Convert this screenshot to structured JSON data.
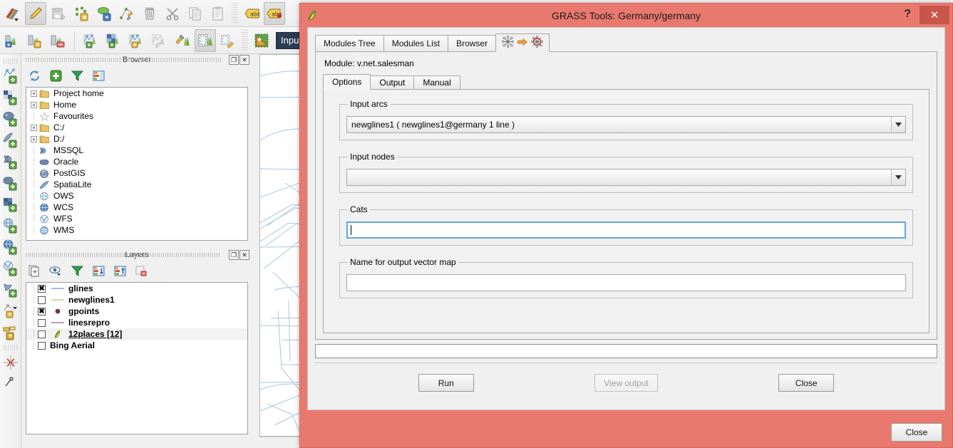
{
  "app": {
    "toolbar_row1": [
      {
        "name": "pencils-dropdown-icon",
        "label": "Current Edits"
      },
      {
        "name": "toggle-editing-icon",
        "label": "Toggle Editing",
        "active": true
      },
      {
        "name": "save-layer-edits-icon",
        "label": "Save Layer Edits"
      },
      {
        "name": "add-feature-icon",
        "label": "Add Feature"
      },
      {
        "name": "move-feature-icon",
        "label": "Move Feature"
      },
      {
        "name": "node-tool-icon",
        "label": "Node Tool"
      },
      {
        "name": "delete-selected-icon",
        "label": "Delete Selected"
      },
      {
        "name": "cut-features-icon",
        "label": "Cut Features"
      },
      {
        "name": "copy-features-icon",
        "label": "Copy Features"
      },
      {
        "name": "paste-features-icon",
        "label": "Paste Features"
      },
      {
        "name": "label-icon",
        "label": "Layer Labeling Options"
      },
      {
        "name": "label-pin-icon",
        "label": "Pin Labels",
        "active": true
      }
    ],
    "toolbar_row2": [
      {
        "name": "grass-open-mapset-icon",
        "label": "Open Mapset"
      },
      {
        "name": "grass-new-mapset-icon",
        "label": "New Mapset"
      },
      {
        "name": "grass-close-mapset-icon",
        "label": "Close Mapset"
      },
      {
        "name": "grass-add-vector-icon",
        "label": "Add GRASS Vector Layer"
      },
      {
        "name": "grass-add-raster-icon",
        "label": "Add GRASS Raster Layer"
      },
      {
        "name": "grass-new-vector-icon",
        "label": "Create New GRASS Vector Layer"
      },
      {
        "name": "grass-edit-vector-icon",
        "label": "Edit GRASS Vector Layer"
      },
      {
        "name": "grass-tools-icon",
        "label": "Open GRASS Tools"
      },
      {
        "name": "grass-region-icon",
        "label": "Display Current GRASS Region",
        "active": true
      },
      {
        "name": "grass-edit-region-icon",
        "label": "Edit Current GRASS Region"
      },
      {
        "name": "select-features-icon",
        "label": "Select Features"
      }
    ],
    "toolbar_combo_value": "Input",
    "left_toolbar": [
      {
        "name": "add-vector-layer-icon",
        "label": "Add Vector Layer"
      },
      {
        "name": "add-raster-layer-icon",
        "label": "Add Raster Layer"
      },
      {
        "name": "add-postgis-layer-icon",
        "label": "Add PostGIS Layer"
      },
      {
        "name": "add-spatialite-layer-icon",
        "label": "Add SpatiaLite Layer"
      },
      {
        "name": "add-mssql-layer-icon",
        "label": "Add MSSQL Spatial Layer"
      },
      {
        "name": "add-oracle-layer-icon",
        "label": "Add Oracle Spatial Layer"
      },
      {
        "name": "add-db2-layer-icon",
        "label": "Add DB2 Spatial Layer"
      },
      {
        "name": "add-wms-layer-icon",
        "label": "Add WMS/WMTS Layer"
      },
      {
        "name": "add-wcs-layer-icon",
        "label": "Add WCS Layer"
      },
      {
        "name": "add-wfs-layer-icon",
        "label": "Add WFS Layer"
      },
      {
        "name": "add-delimited-text-layer-icon",
        "label": "Add Delimited Text Layer"
      },
      {
        "name": "new-shapefile-layer-icon",
        "label": "New Shapefile Layer"
      },
      {
        "name": "new-spatialite-layer-icon",
        "label": "New SpatiaLite Layer"
      },
      {
        "name": "georeferencer-icon",
        "label": "Georeferencer"
      }
    ]
  },
  "browser_panel": {
    "title": "Browser",
    "tools": [
      {
        "name": "refresh-icon",
        "label": "Refresh"
      },
      {
        "name": "add-selected-layers-icon",
        "label": "Add Selected Layers"
      },
      {
        "name": "filter-browser-icon",
        "label": "Filter Browser"
      },
      {
        "name": "collapse-all-icon",
        "label": "Collapse All"
      }
    ],
    "items": [
      {
        "label": "Project home",
        "icon": "folder-icon",
        "expandable": true
      },
      {
        "label": "Home",
        "icon": "folder-icon",
        "expandable": true
      },
      {
        "label": "Favourites",
        "icon": "star-icon",
        "expandable": false
      },
      {
        "label": "C:/",
        "icon": "folder-icon",
        "expandable": true
      },
      {
        "label": "D:/",
        "icon": "folder-icon",
        "expandable": true
      },
      {
        "label": "MSSQL",
        "icon": "mssql-icon",
        "expandable": false
      },
      {
        "label": "Oracle",
        "icon": "oracle-icon",
        "expandable": false
      },
      {
        "label": "PostGIS",
        "icon": "postgis-icon",
        "expandable": false
      },
      {
        "label": "SpatiaLite",
        "icon": "spatialite-icon",
        "expandable": false
      },
      {
        "label": "OWS",
        "icon": "ows-icon",
        "expandable": false
      },
      {
        "label": "WCS",
        "icon": "wcs-icon",
        "expandable": false
      },
      {
        "label": "WFS",
        "icon": "wfs-icon",
        "expandable": false
      },
      {
        "label": "WMS",
        "icon": "wms-icon",
        "expandable": false
      }
    ],
    "dock_buttons": [
      {
        "name": "float-panel-button",
        "glyph": "❐"
      },
      {
        "name": "close-panel-button",
        "glyph": "✕"
      }
    ]
  },
  "layers_panel": {
    "title": "Layers",
    "tools": [
      {
        "name": "layer-group-icon",
        "label": "Add Group"
      },
      {
        "name": "manage-visibility-icon",
        "label": "Manage Layer Visibility"
      },
      {
        "name": "filter-legend-icon",
        "label": "Filter Legend"
      },
      {
        "name": "expand-all-icon",
        "label": "Expand All"
      },
      {
        "name": "collapse-all-icon",
        "label": "Collapse All"
      },
      {
        "name": "remove-layer-icon",
        "label": "Remove Layer"
      }
    ],
    "items": [
      {
        "label": "glines",
        "checked": true,
        "symbol": "line",
        "color": "#7da8d8",
        "selected": false,
        "underline": false,
        "indent": true
      },
      {
        "label": "newglines1",
        "checked": false,
        "symbol": "line",
        "color": "#c9cf93",
        "selected": false,
        "underline": false,
        "indent": true
      },
      {
        "label": "gpoints",
        "checked": true,
        "symbol": "point",
        "color": "#6b3361",
        "selected": false,
        "underline": false,
        "indent": true
      },
      {
        "label": "linesrepro",
        "checked": false,
        "symbol": "line",
        "color": "#b86fc0",
        "selected": false,
        "underline": false,
        "indent": true
      },
      {
        "label": "12places [12]",
        "checked": false,
        "symbol": "grass",
        "color": "#7c9d4e",
        "selected": true,
        "underline": true,
        "indent": true
      },
      {
        "label": "Bing Aerial",
        "checked": false,
        "symbol": "none",
        "color": "",
        "selected": false,
        "underline": false,
        "indent": false
      }
    ],
    "dock_buttons": [
      {
        "name": "float-panel-button",
        "glyph": "❐"
      },
      {
        "name": "close-panel-button",
        "glyph": "✕"
      }
    ]
  },
  "grass_dialog": {
    "title": "GRASS Tools: Germany/germany",
    "icon": "grass-leaf-icon",
    "help_glyph": "?",
    "close_glyph": "✕",
    "tabs": [
      {
        "label": "Modules Tree",
        "selected": false,
        "icons": false
      },
      {
        "label": "Modules List",
        "selected": false,
        "icons": false
      },
      {
        "label": "Browser",
        "selected": false,
        "icons": false
      },
      {
        "label": "",
        "selected": true,
        "icons": true
      }
    ],
    "module_label": "Module: v.net.salesman",
    "inner_tabs": [
      {
        "label": "Options",
        "selected": true
      },
      {
        "label": "Output",
        "selected": false
      },
      {
        "label": "Manual",
        "selected": false
      }
    ],
    "fields": [
      {
        "name": "input-arcs",
        "legend": "Input arcs",
        "type": "combo",
        "value": "newglines1 ( newglines1@germany 1 line )"
      },
      {
        "name": "input-nodes",
        "legend": "Input nodes",
        "type": "combo",
        "value": ""
      },
      {
        "name": "cats",
        "legend": "Cats",
        "type": "text",
        "value": "",
        "focused": true
      },
      {
        "name": "output-vector-map",
        "legend": "Name for output vector map",
        "type": "text",
        "value": "",
        "focused": false
      }
    ],
    "progress_value": "",
    "buttons": [
      {
        "name": "run-button",
        "label": "Run",
        "disabled": false
      },
      {
        "name": "view-output-button",
        "label": "View output",
        "disabled": true
      },
      {
        "name": "close-dialog-button",
        "label": "Close",
        "disabled": false
      }
    ],
    "footer_button": {
      "name": "close-window-button",
      "label": "Close"
    }
  },
  "colors": {
    "dialog_chrome": "#e9796e",
    "dialog_close": "#c9564b",
    "panel_bg": "#f0f0f0",
    "focus_blue": "#5fa7e0",
    "map_roads": "#a8c6e0"
  }
}
